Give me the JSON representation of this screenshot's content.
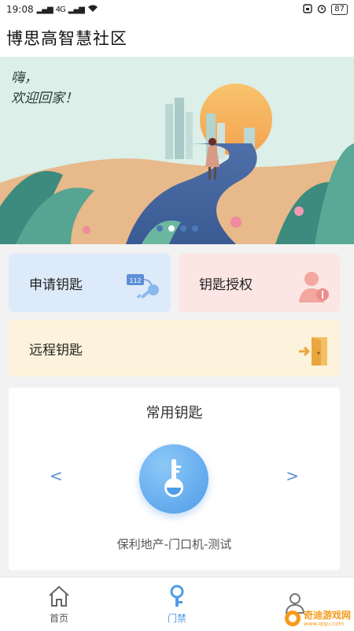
{
  "status": {
    "time": "19:08",
    "signal": "4G",
    "battery": "87"
  },
  "header": {
    "title": "博思高智慧社区"
  },
  "banner": {
    "line1": "嗨，",
    "line2": "欢迎回家！",
    "slides": 4,
    "active_slide": 1
  },
  "actions": {
    "apply_key": "申请钥匙",
    "key_auth": "钥匙授权",
    "remote_key": "远程钥匙",
    "key_tag_text": "112"
  },
  "favorites": {
    "title": "常用钥匙",
    "key_name": "保利地产-门口机-测试",
    "prev": "<",
    "next": ">"
  },
  "tabs": [
    {
      "label": "首页",
      "icon": "home-icon"
    },
    {
      "label": "门禁",
      "icon": "key-icon"
    },
    {
      "label": "",
      "icon": "user-icon"
    }
  ],
  "active_tab": 1,
  "watermark": {
    "text": "奇迪游戏网",
    "url": "www.qiqu.com"
  },
  "colors": {
    "accent": "#4f9ce8",
    "apply_bg": "#ddeaf9",
    "auth_bg": "#fbe6e4",
    "remote_bg": "#fdf3dc"
  }
}
